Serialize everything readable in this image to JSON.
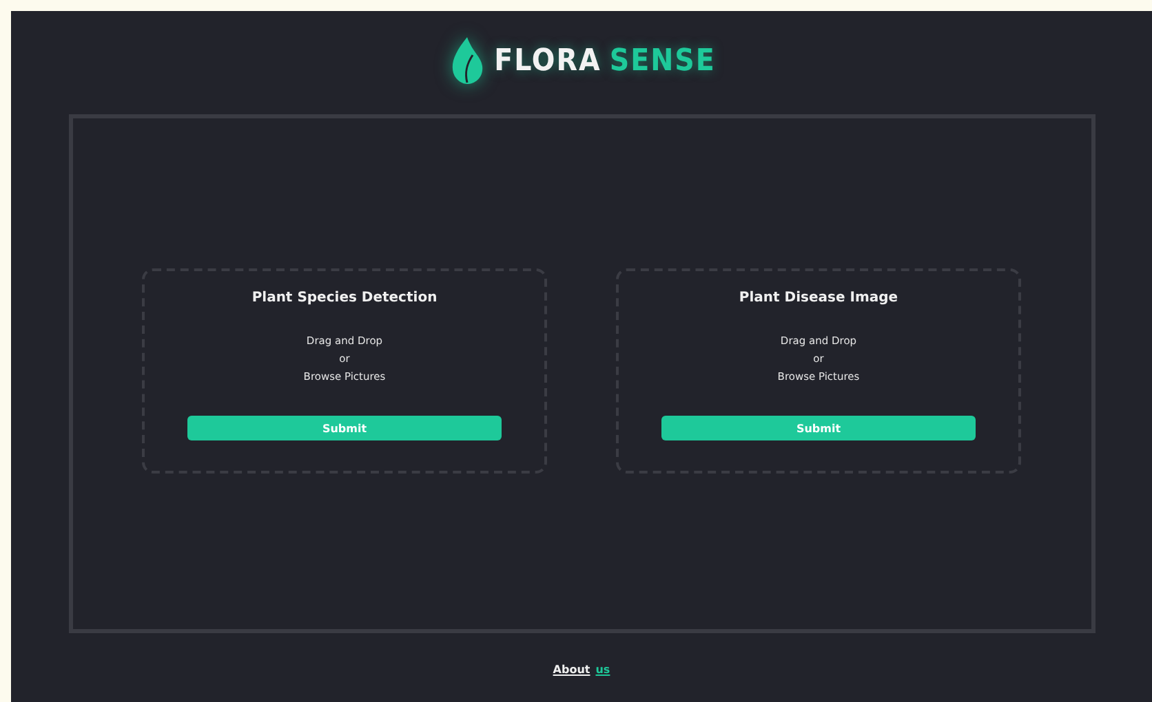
{
  "brand": {
    "first": "FLORA",
    "second": "SENSE"
  },
  "cards": [
    {
      "title": "Plant Species Detection",
      "lines": [
        "Drag and Drop",
        "or",
        "Browse Pictures"
      ],
      "button": "Submit"
    },
    {
      "title": "Plant Disease Image",
      "lines": [
        "Drag and Drop",
        "or",
        "Browse Pictures"
      ],
      "button": "Submit"
    }
  ],
  "footer": {
    "link_first": "About",
    "link_second": "us"
  }
}
